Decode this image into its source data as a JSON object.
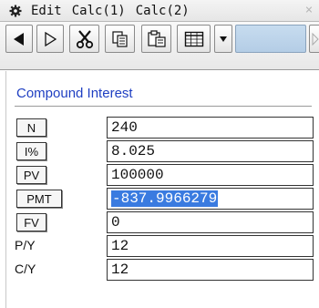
{
  "menubar": {
    "icon": "gear-icon",
    "items": [
      "Edit",
      "Calc(1)",
      "Calc(2)"
    ],
    "close_label": "×"
  },
  "toolbar": {
    "buttons": [
      "back-arrow-icon",
      "forward-arrow-icon",
      "cut-icon",
      "copy-icon",
      "paste-icon",
      "table-icon",
      "dropdown-icon",
      "next-icon"
    ]
  },
  "section_title": "Compound Interest",
  "fields": [
    {
      "label": "N",
      "value": "240",
      "button": true
    },
    {
      "label": "I%",
      "value": "8.025",
      "button": true
    },
    {
      "label": "PV",
      "value": "100000",
      "button": true
    },
    {
      "label": "PMT",
      "value": "-837.9966279",
      "button": true,
      "selected": true
    },
    {
      "label": "FV",
      "value": "0",
      "button": true
    },
    {
      "label": "P/Y",
      "value": "12",
      "button": false
    },
    {
      "label": "C/Y",
      "value": "12",
      "button": false
    }
  ],
  "colors": {
    "title": "#1f3fc2",
    "selection": "#3a7be0"
  }
}
